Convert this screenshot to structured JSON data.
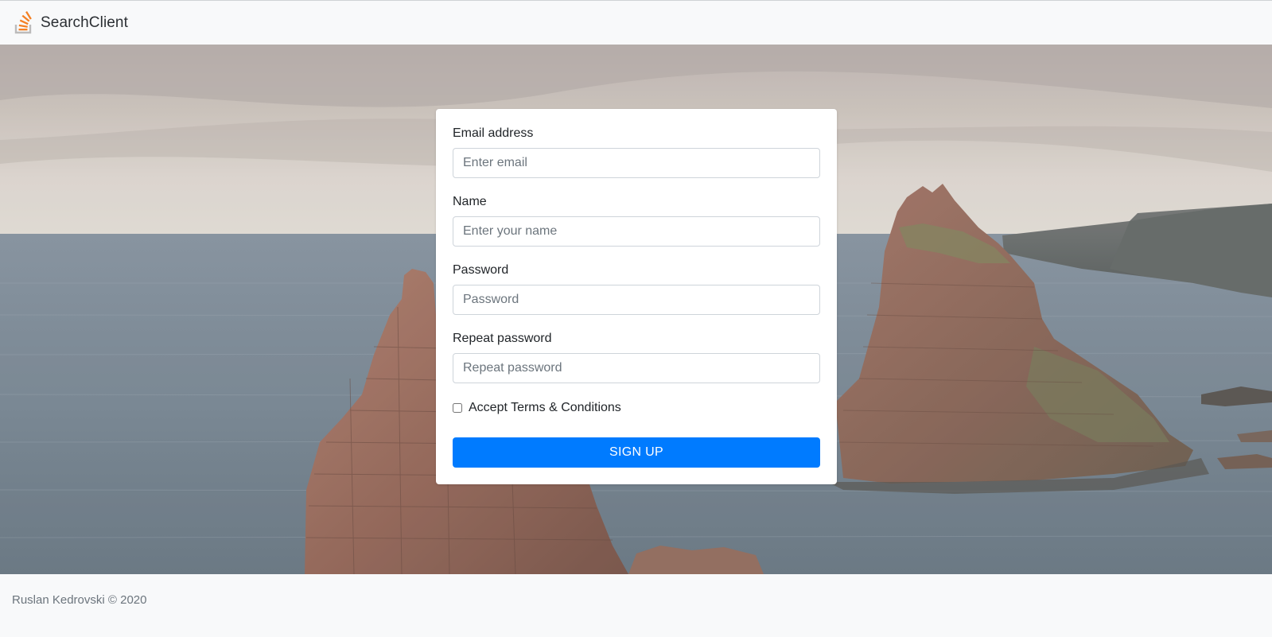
{
  "navbar": {
    "brand_name": "SearchClient",
    "brand_icon": "stack-overflow-logo-icon",
    "brand_color": "#f48024"
  },
  "hero": {
    "background": "sea-stacks-photo"
  },
  "form": {
    "email": {
      "label": "Email address",
      "placeholder": "Enter email",
      "value": ""
    },
    "name": {
      "label": "Name",
      "placeholder": "Enter your name",
      "value": ""
    },
    "password": {
      "label": "Password",
      "placeholder": "Password",
      "value": ""
    },
    "repeat_password": {
      "label": "Repeat password",
      "placeholder": "Repeat password",
      "value": ""
    },
    "terms": {
      "label": "Accept Terms & Conditions",
      "checked": false
    },
    "submit_label": "SIGN UP",
    "submit_color": "#007bff"
  },
  "footer": {
    "copyright": "Ruslan Kedrovski © 2020"
  }
}
